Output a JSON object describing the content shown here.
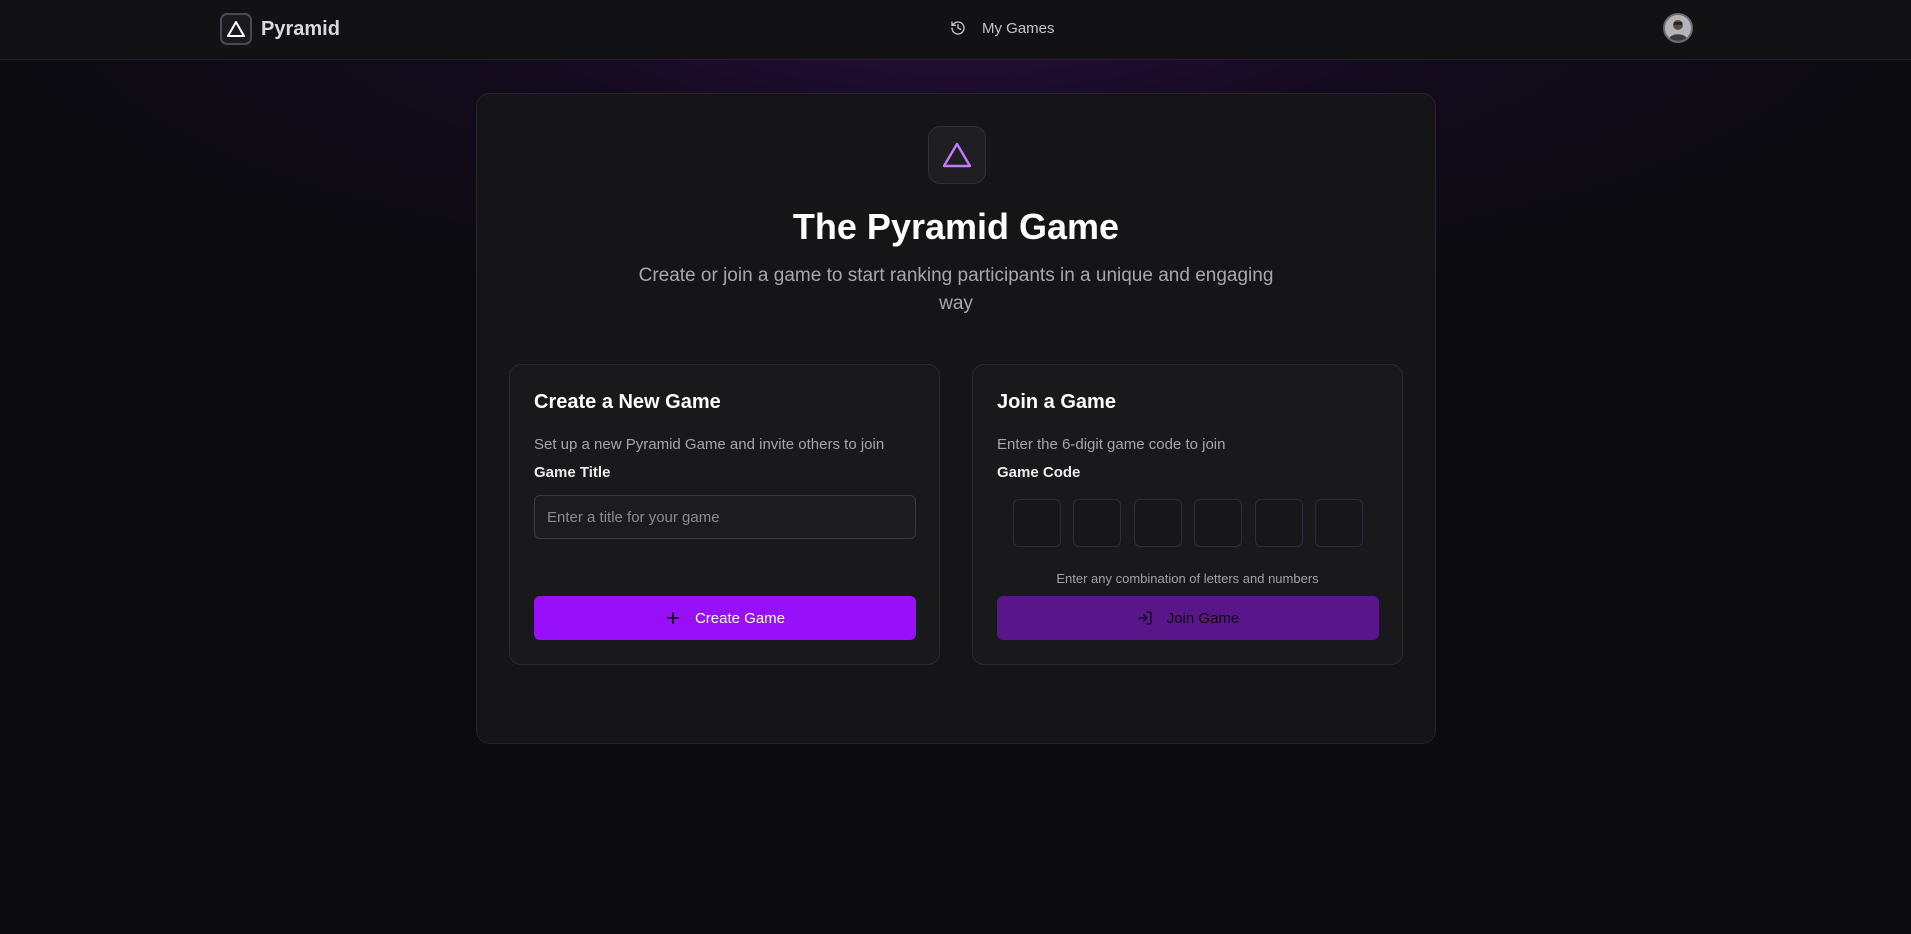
{
  "header": {
    "brand_name": "Pyramid",
    "nav_games_label": "My Games",
    "nav_games_icon": "history-icon",
    "avatar_icon": "user-avatar"
  },
  "hero": {
    "icon": "triangle-icon",
    "title": "The Pyramid Game",
    "subtitle": "Create or join a game to start ranking participants in a unique and engaging way"
  },
  "create_panel": {
    "heading": "Create a New Game",
    "description": "Set up a new Pyramid Game and invite others to join",
    "field_label": "Game Title",
    "input_value": "",
    "input_placeholder": "Enter a title for your game",
    "button_label": "Create Game",
    "button_icon": "plus-icon"
  },
  "join_panel": {
    "heading": "Join a Game",
    "description": "Enter the 6-digit game code to join",
    "field_label": "Game Code",
    "code_values": [
      "",
      "",
      "",
      "",
      "",
      ""
    ],
    "hint": "Enter any combination of letters and numbers",
    "button_label": "Join Game",
    "button_icon": "log-in-icon"
  },
  "colors": {
    "accent": "#9810fa",
    "accent_muted": "#59168b",
    "accent_icon": "#c27aff",
    "background": "#0b0b0e",
    "card": "#151518"
  }
}
